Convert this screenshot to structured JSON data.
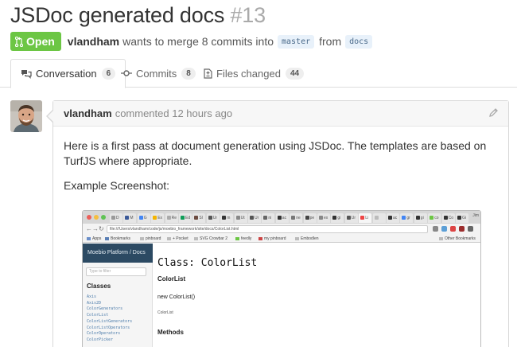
{
  "pull_request": {
    "title": "JSDoc generated docs",
    "number": "#13",
    "state": "Open",
    "author": "vlandham",
    "merge_text": "wants to merge 8 commits into",
    "base_branch": "master",
    "from_text": "from",
    "head_branch": "docs"
  },
  "tabs": [
    {
      "label": "Conversation",
      "count": "6"
    },
    {
      "label": "Commits",
      "count": "8"
    },
    {
      "label": "Files changed",
      "count": "44"
    }
  ],
  "comment": {
    "author": "vlandham",
    "action": "commented 12 hours ago",
    "paragraph1": "Here is a first pass at document generation using JSDoc. The templates are based on TurfJS where appropriate.",
    "paragraph2": "Example Screenshot:"
  },
  "screenshot": {
    "browser_tabs": [
      "D",
      "M",
      "G",
      "Ex",
      "Re",
      "Ed",
      "Sl",
      "Ur",
      "m",
      "Ut",
      "Ur",
      "ni",
      "ac",
      "ne",
      "pe",
      "ex",
      "gi",
      "Ur",
      "Li",
      "",
      "ac",
      "gr",
      "gi",
      "co",
      "Co",
      "Gi"
    ],
    "window_user": "Jim",
    "url": "file:///Users/vlandham/code/js/moebio_framework/site/docs/ColorList.html",
    "bookmarks": [
      "Apps",
      "Bookmarks",
      "pinboard",
      "+ Pocket",
      "SVG Crowbar 2",
      "feedly",
      "my pinboard",
      "Embodlen"
    ],
    "other_bookmarks": "Other Bookmarks",
    "sidebar_title": "Moebio Platform / Docs",
    "filter_placeholder": "Type to filter",
    "classes_heading": "Classes",
    "classes": [
      "Axis",
      "Axis2D",
      "ColorGenerators",
      "ColorList",
      "ColorListGenerators",
      "ColorListOperators",
      "ColorOperators",
      "ColorPicker"
    ],
    "heading": "Class: ColorList",
    "subheading": "ColorList",
    "constructor": "new ColorList()",
    "constructor_desc": "ColorList",
    "methods_heading": "Methods"
  },
  "colors": {
    "open_badge": "#6cc644",
    "link": "#4b7baa",
    "sidebar_header": "#2c4a63"
  },
  "icons": [
    "git-pull-request-icon",
    "conversation-icon",
    "commit-icon",
    "file-diff-icon",
    "pencil-icon"
  ]
}
